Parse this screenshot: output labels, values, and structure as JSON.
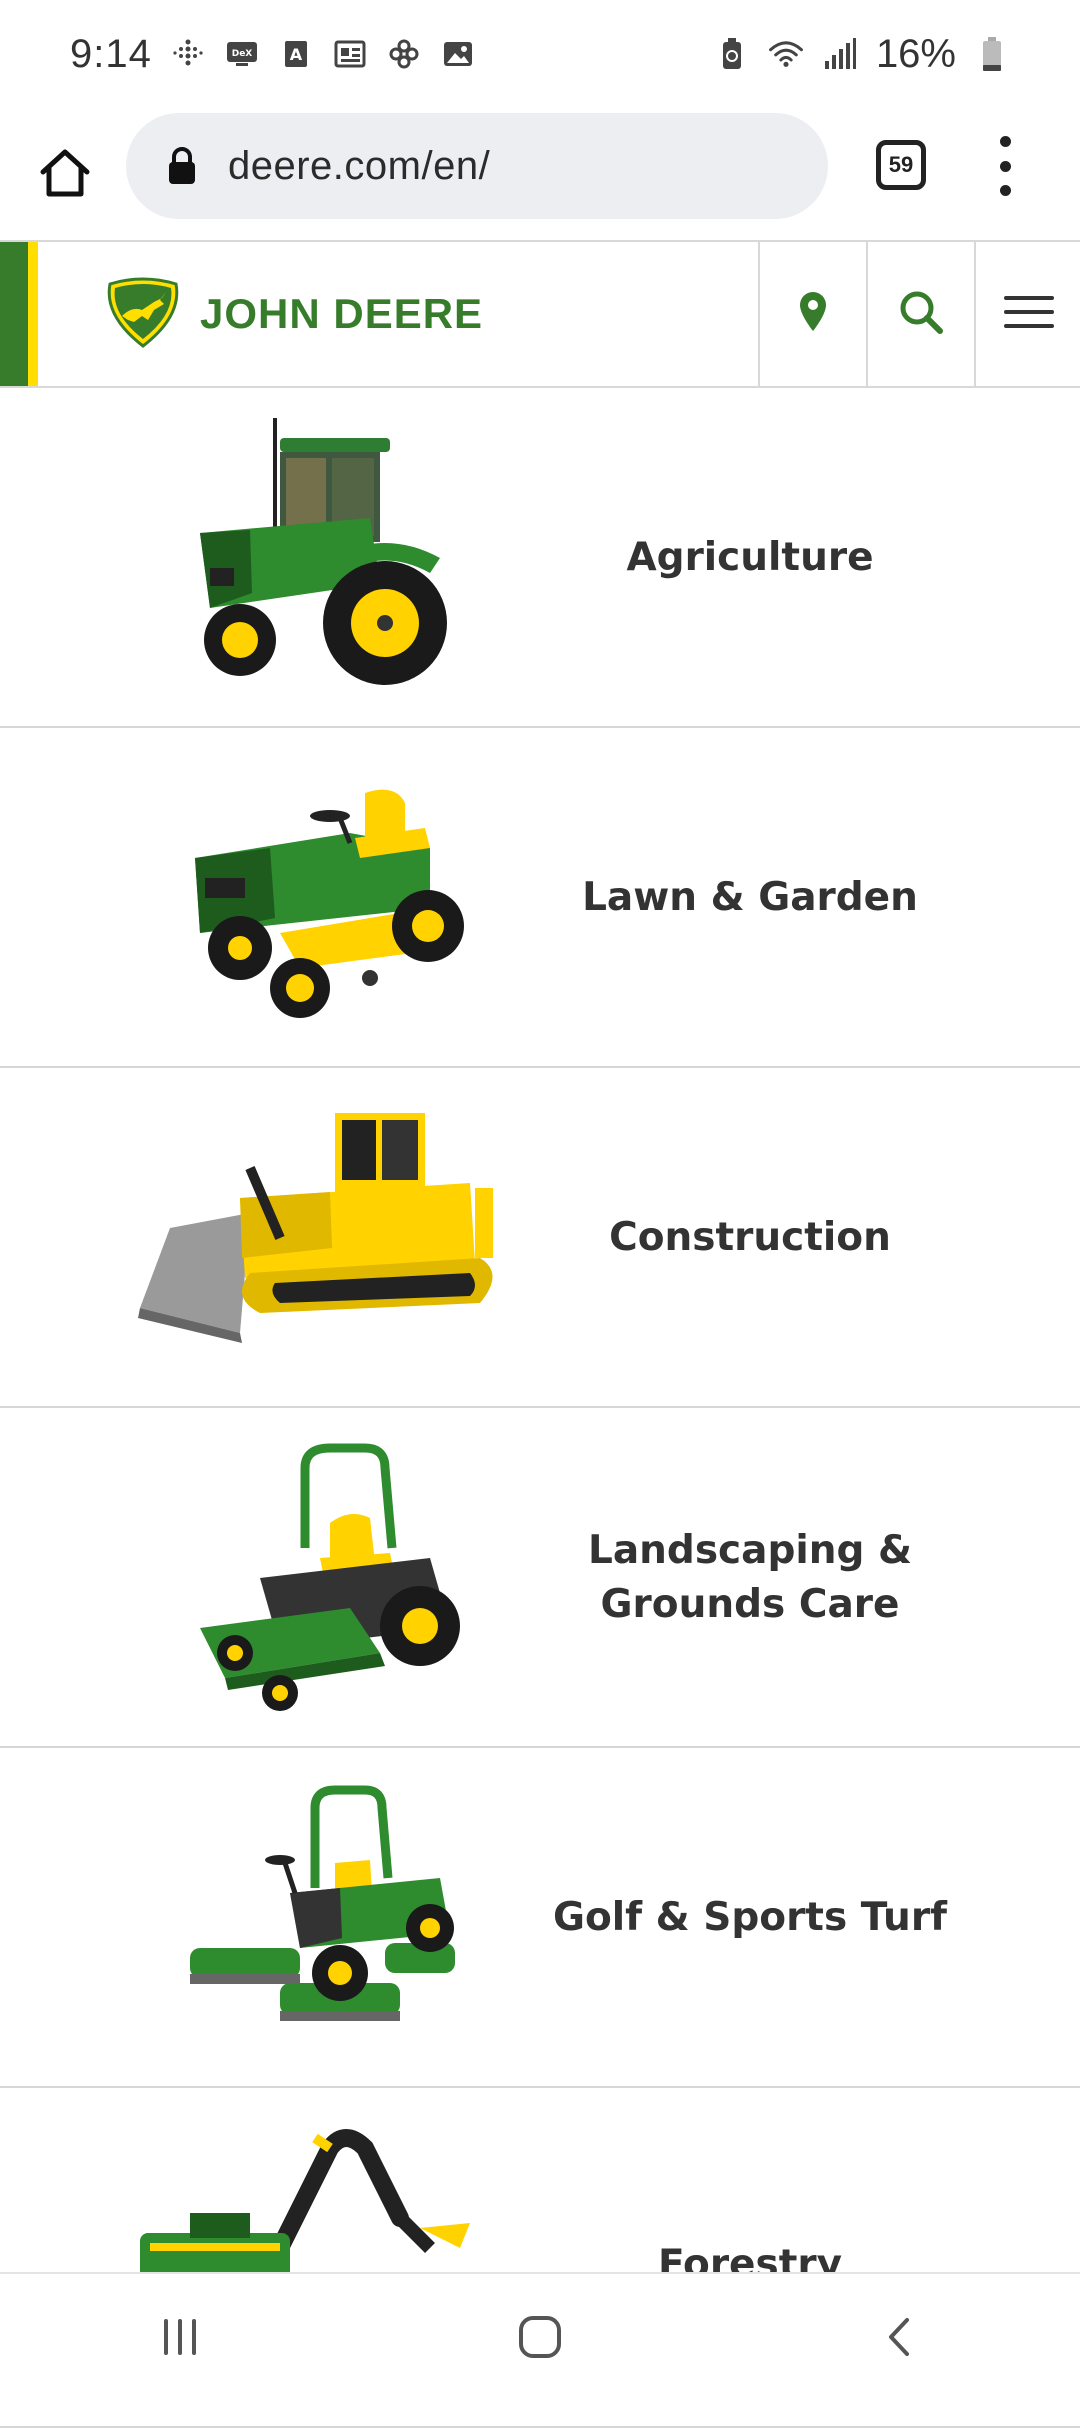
{
  "status_bar": {
    "time": "9:14",
    "battery_percent": "16%",
    "left_icons": [
      "fitness-icon",
      "dex-icon",
      "a-icon",
      "news-icon",
      "pinwheel-icon",
      "gallery-icon"
    ],
    "right_icons": [
      "battery-saver-icon",
      "wifi-icon",
      "signal-icon",
      "battery-icon"
    ]
  },
  "browser": {
    "url": "deere.com/en/",
    "tab_count": "59"
  },
  "site": {
    "brand_name": "JOHN DEERE",
    "brand_color": "#367c2b",
    "accent_color": "#ffde00"
  },
  "categories": [
    {
      "label": "Agriculture",
      "icon": "tractor-image"
    },
    {
      "label": "Lawn & Garden",
      "icon": "riding-mower-image"
    },
    {
      "label": "Construction",
      "icon": "bulldozer-image"
    },
    {
      "label": "Landscaping & Grounds Care",
      "icon": "zero-turn-mower-image"
    },
    {
      "label": "Golf & Sports Turf",
      "icon": "reel-mower-image"
    },
    {
      "label": "Forestry",
      "icon": "forestry-harvester-image"
    }
  ],
  "nav_bar": {
    "buttons": [
      "recents-button",
      "home-button",
      "back-button"
    ]
  }
}
